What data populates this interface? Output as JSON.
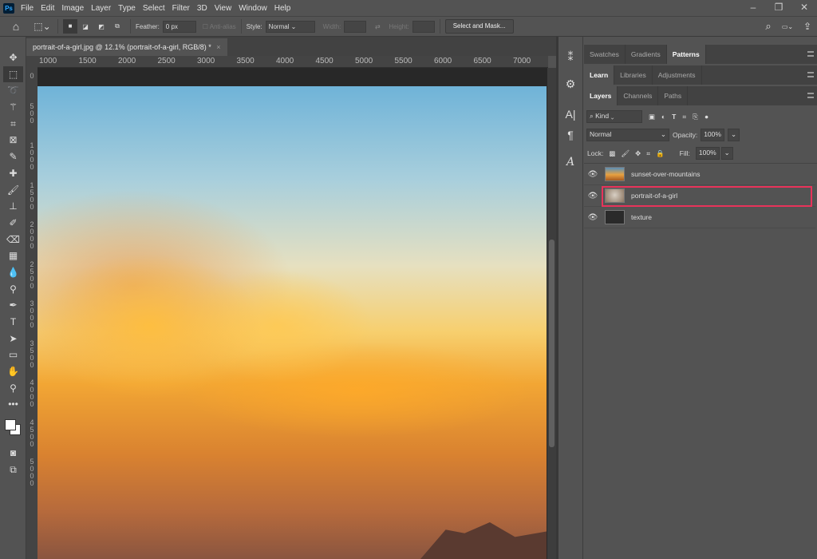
{
  "app": {
    "logo": "Ps",
    "menu": [
      "File",
      "Edit",
      "Image",
      "Layer",
      "Type",
      "Select",
      "Filter",
      "3D",
      "View",
      "Window",
      "Help"
    ],
    "window_controls": [
      "minimize",
      "restore",
      "close"
    ]
  },
  "options": {
    "feather_label": "Feather:",
    "feather_value": "0 px",
    "anti_alias": "Anti-alias",
    "style_label": "Style:",
    "style_value": "Normal",
    "width_label": "Width:",
    "height_label": "Height:",
    "select_mask": "Select and Mask..."
  },
  "document": {
    "tab_title": "portrait-of-a-girl.jpg @ 12.1% (portrait-of-a-girl, RGB/8) *",
    "close": "×"
  },
  "ruler": {
    "h": [
      "1000",
      "1500",
      "2000",
      "2500",
      "3000",
      "3500",
      "4000",
      "4500",
      "5000",
      "5500",
      "6000",
      "6500",
      "7000"
    ],
    "v": [
      "0",
      "500",
      "1000",
      "1500",
      "2000",
      "2500",
      "3000",
      "3500",
      "4000",
      "4500",
      "5000"
    ]
  },
  "panels": {
    "row1": [
      "Swatches",
      "Gradients",
      "Patterns"
    ],
    "row2": [
      "Learn",
      "Libraries",
      "Adjustments"
    ],
    "row3": [
      "Layers",
      "Channels",
      "Paths"
    ],
    "filter_kind": "Kind",
    "blend_mode": "Normal",
    "opacity_label": "Opacity:",
    "opacity_value": "100%",
    "lock_label": "Lock:",
    "fill_label": "Fill:",
    "fill_value": "100%",
    "layers": [
      {
        "name": "sunset-over-mountains",
        "selected": false
      },
      {
        "name": "portrait-of-a-girl",
        "selected": true
      },
      {
        "name": "texture",
        "selected": false
      }
    ]
  },
  "colors": {
    "highlight": "#e8335a",
    "bg": "#535353"
  }
}
